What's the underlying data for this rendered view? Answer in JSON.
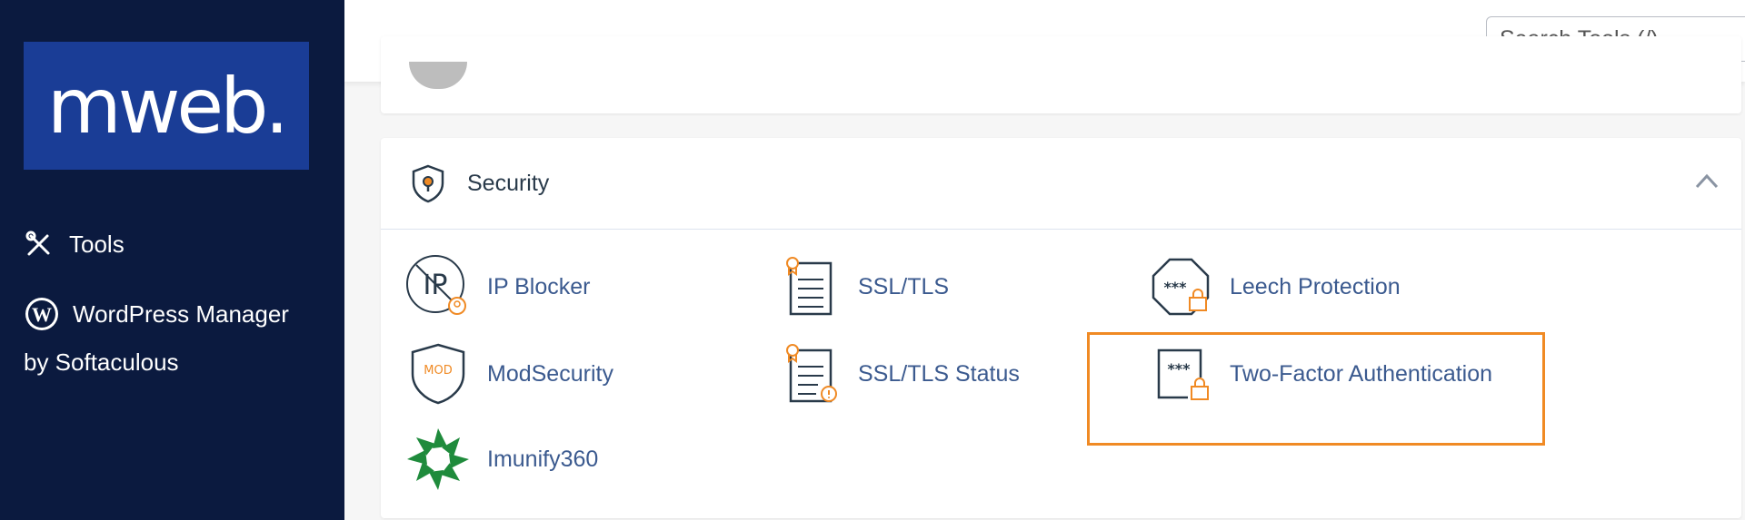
{
  "sidebar": {
    "logo_text": "mweb.",
    "items": [
      {
        "label": "Tools",
        "icon": "tools-icon"
      },
      {
        "label": "WordPress Manager",
        "icon": "wordpress-icon"
      },
      {
        "label": "by Softaculous"
      }
    ]
  },
  "header": {
    "search_placeholder": "Search Tools (/)"
  },
  "panel": {
    "title": "Security",
    "tools": [
      {
        "label": "IP Blocker",
        "icon": "ip-blocker-icon"
      },
      {
        "label": "SSL/TLS",
        "icon": "ssl-tls-icon"
      },
      {
        "label": "Leech Protection",
        "icon": "leech-protection-icon"
      },
      {
        "label": "ModSecurity",
        "icon": "modsecurity-icon"
      },
      {
        "label": "SSL/TLS Status",
        "icon": "ssl-tls-status-icon"
      },
      {
        "label": "Two-Factor Authentication",
        "icon": "two-factor-icon"
      },
      {
        "label": "Imunify360",
        "icon": "imunify360-icon"
      }
    ],
    "mod_text": "MOD",
    "asterisks": "***"
  },
  "colors": {
    "sidebar_bg": "#0b1a3f",
    "logo_bg": "#1a3d96",
    "link": "#3b5a8f",
    "accent": "#f08a24",
    "imunify_green": "#1f8b3c"
  }
}
